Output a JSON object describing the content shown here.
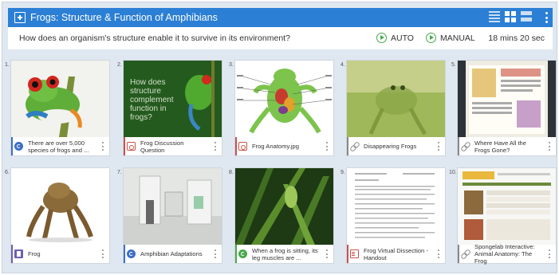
{
  "header": {
    "title": "Frogs: Structure & Function of Amphibians",
    "view_icons": [
      "list-view-icon",
      "grid-view-icon",
      "wide-view-icon"
    ],
    "accent": "#2b7fd4"
  },
  "subbar": {
    "question": "How does an organism's structure enable it to survive in its environment?",
    "auto_label": "AUTO",
    "manual_label": "MANUAL",
    "timer": "18 mins 20 sec"
  },
  "cards": [
    {
      "num": "1.",
      "label": "There are over 5,000 species of frogs and ...",
      "icon": "quiz-icon",
      "type_color": "#3c6fc8"
    },
    {
      "num": "2.",
      "label": "Frog Discussion Question",
      "icon": "image-icon",
      "type_color": "#c8524a",
      "thumb_text": "How does structure complement function in frogs?"
    },
    {
      "num": "3.",
      "label": "Frog Anatomy.jpg",
      "icon": "image-icon",
      "type_color": "#c8524a"
    },
    {
      "num": "4.",
      "label": "Disappearing Frogs",
      "icon": "link-icon",
      "type_color": "#888888"
    },
    {
      "num": "5.",
      "label": "Where Have All the Frogs Gone?",
      "icon": "link-icon",
      "type_color": "#888888"
    },
    {
      "num": "6.",
      "label": "Frog",
      "icon": "book-icon",
      "type_color": "#6d5fb0"
    },
    {
      "num": "7.",
      "label": "Amphibian Adaptations",
      "icon": "quiz-icon",
      "type_color": "#3c6fc8"
    },
    {
      "num": "8.",
      "label": "When a frog is sitting, its leg muscles are ...",
      "icon": "quiz-icon",
      "type_color": "#49a84b"
    },
    {
      "num": "9.",
      "label": "Frog Virtual Dissection - Handout",
      "icon": "document-icon",
      "type_color": "#c8524a"
    },
    {
      "num": "10.",
      "label": "Spongelab Interactive: Animal Anatomy: The Frog",
      "icon": "link-icon",
      "type_color": "#888888"
    }
  ]
}
